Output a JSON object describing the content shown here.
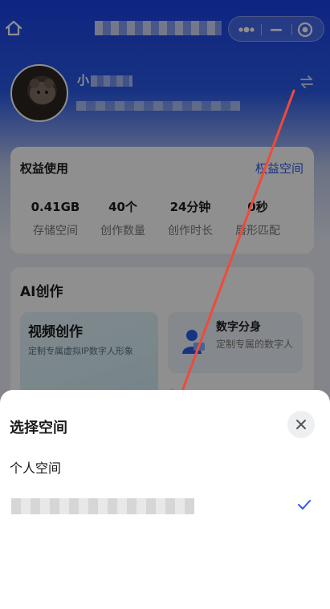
{
  "colors": {
    "brand_blue": "#1a43e6",
    "link_blue": "#2c5be8",
    "check_blue": "#2c5be8",
    "arrow_red": "#f04a3a",
    "mask": "rgba(0,0,0,0.44)"
  },
  "topbar": {
    "home_icon": "home-icon",
    "title": "",
    "capsule": {
      "more_icon": "more-dots-icon",
      "minimize_icon": "minimize-icon",
      "close_icon": "target-close-icon"
    }
  },
  "profile": {
    "name_prefix": "小",
    "avatar_icon": "avatar",
    "switch_icon": "switch-arrows-icon"
  },
  "usage": {
    "title": "权益使用",
    "link": "权益空间",
    "stats": [
      {
        "value": "0.41GB",
        "label": "存储空间"
      },
      {
        "value": "40个",
        "label": "创作数量"
      },
      {
        "value": "24分钟",
        "label": "创作时长"
      },
      {
        "value": "0秒",
        "label": "唇形匹配"
      }
    ]
  },
  "ai": {
    "title": "AI创作",
    "video": {
      "title": "视频创作",
      "subtitle": "定制专属虚拟IP数字人形象"
    },
    "twin": {
      "title": "数字分身",
      "subtitle": "定制专属的数字人"
    }
  },
  "sheet": {
    "title": "选择空间",
    "close_icon": "close-icon",
    "options": [
      {
        "label": "个人空间",
        "selected": false
      },
      {
        "label": "",
        "selected": true
      }
    ],
    "check_icon": "check-icon"
  }
}
